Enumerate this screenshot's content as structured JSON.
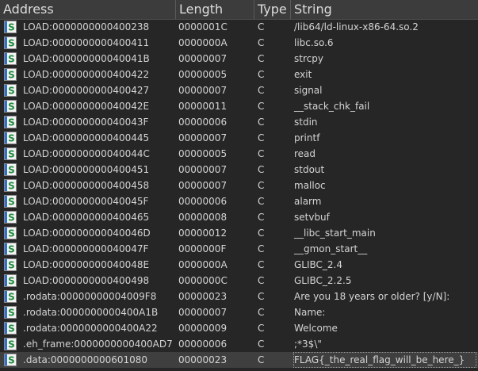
{
  "columns": {
    "address": "Address",
    "length": "Length",
    "type": "Type",
    "string": "String"
  },
  "icon": {
    "name": "string-s-icon",
    "glyph": "S",
    "color": "#1f8a3a"
  },
  "rows": [
    {
      "address": "LOAD:0000000000400238",
      "length": "0000001C",
      "type": "C",
      "string": "/lib64/ld-linux-x86-64.so.2"
    },
    {
      "address": "LOAD:0000000000400411",
      "length": "0000000A",
      "type": "C",
      "string": "libc.so.6"
    },
    {
      "address": "LOAD:000000000040041B",
      "length": "00000007",
      "type": "C",
      "string": "strcpy"
    },
    {
      "address": "LOAD:0000000000400422",
      "length": "00000005",
      "type": "C",
      "string": "exit"
    },
    {
      "address": "LOAD:0000000000400427",
      "length": "00000007",
      "type": "C",
      "string": "signal"
    },
    {
      "address": "LOAD:000000000040042E",
      "length": "00000011",
      "type": "C",
      "string": "__stack_chk_fail"
    },
    {
      "address": "LOAD:000000000040043F",
      "length": "00000006",
      "type": "C",
      "string": "stdin"
    },
    {
      "address": "LOAD:0000000000400445",
      "length": "00000007",
      "type": "C",
      "string": "printf"
    },
    {
      "address": "LOAD:000000000040044C",
      "length": "00000005",
      "type": "C",
      "string": "read"
    },
    {
      "address": "LOAD:0000000000400451",
      "length": "00000007",
      "type": "C",
      "string": "stdout"
    },
    {
      "address": "LOAD:0000000000400458",
      "length": "00000007",
      "type": "C",
      "string": "malloc"
    },
    {
      "address": "LOAD:000000000040045F",
      "length": "00000006",
      "type": "C",
      "string": "alarm"
    },
    {
      "address": "LOAD:0000000000400465",
      "length": "00000008",
      "type": "C",
      "string": "setvbuf"
    },
    {
      "address": "LOAD:000000000040046D",
      "length": "00000012",
      "type": "C",
      "string": "__libc_start_main"
    },
    {
      "address": "LOAD:000000000040047F",
      "length": "0000000F",
      "type": "C",
      "string": "__gmon_start__"
    },
    {
      "address": "LOAD:000000000040048E",
      "length": "0000000A",
      "type": "C",
      "string": "GLIBC_2.4"
    },
    {
      "address": "LOAD:0000000000400498",
      "length": "0000000C",
      "type": "C",
      "string": "GLIBC_2.2.5"
    },
    {
      "address": ".rodata:00000000004009F8",
      "length": "00000023",
      "type": "C",
      "string": "Are you 18 years or older? [y/N]:"
    },
    {
      "address": ".rodata:0000000000400A1B",
      "length": "00000007",
      "type": "C",
      "string": "Name:"
    },
    {
      "address": ".rodata:0000000000400A22",
      "length": "00000009",
      "type": "C",
      "string": "Welcome"
    },
    {
      "address": ".eh_frame:0000000000400AD7",
      "length": "00000006",
      "type": "C",
      "string": ";*3$\\\""
    },
    {
      "address": ".data:0000000000601080",
      "length": "00000023",
      "type": "C",
      "string": "FLAG{_the_real_flag_will_be_here_}",
      "selected": true
    }
  ]
}
